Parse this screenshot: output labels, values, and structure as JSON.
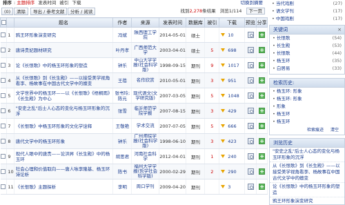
{
  "sortbar": {
    "label": "排序",
    "items": [
      "主题排序",
      "发表时间",
      "被引",
      "下载"
    ],
    "active_index": 0,
    "right_text": "切换到摘要"
  },
  "toolbar": {
    "buttons": [
      "(0)",
      "清除",
      "导出 / 参考文献",
      "分析 / 阅读"
    ],
    "result_prefix": "找到",
    "result_count": "2,278",
    "result_suffix": "条结果",
    "page_text": "浏览1/114",
    "next_label": "下一页"
  },
  "table": {
    "headers": [
      "",
      "题名",
      "作者",
      "来源",
      "发表时间",
      "数据库",
      "被引",
      "下载",
      "预览",
      "分享"
    ],
    "rows": [
      {
        "num": "1",
        "title": "鸦王环形象演变研究",
        "author": "冯斌",
        "source": "陕西理工学院",
        "date": "2014-05-01",
        "db": "硕士",
        "cite": "",
        "downloads": "10"
      },
      {
        "num": "2",
        "title": "唐诗贵妃题材研究",
        "author": "叶丹孝",
        "source": "广西师范大学",
        "date": "2003-04-01",
        "db": "硕士",
        "cite": "5",
        "downloads": "698"
      },
      {
        "num": "3",
        "title": "论《长恨歌》中的杨玉环形象的塑造",
        "author": "钟乐",
        "source": "中山大学学报(社会科学版)",
        "date": "1998-09-15",
        "db": "期刊",
        "cite": "9",
        "downloads": "1017"
      },
      {
        "num": "4",
        "title": "从《长恨歌》到《长生殿》——以接受美学视角看李、杨故事在中国古代文学中的嬗变",
        "author": "王蓓",
        "source": "名作欣赏",
        "date": "2010-05-01",
        "db": "期刊",
        "cite": "3",
        "downloads": "951"
      },
      {
        "num": "5",
        "title": "文学世界中的杨玉环——以《长恨歌》《梧桐雨》《长生殿》为中心",
        "author": "张书玲; 陈元",
        "source": "现代语文(文学研究版)",
        "date": "2007-03-05",
        "db": "期刊",
        "cite": "5",
        "downloads": "1048"
      },
      {
        "num": "6",
        "title": "\"安史之乱\"后士人心态的变化与杨玉环形象的沉浮",
        "author": "张雪",
        "source": "临沂师范学院学报",
        "date": "2007-08-15",
        "db": "期刊",
        "cite": "3",
        "downloads": "429"
      },
      {
        "num": "7",
        "title": "《长恨歌》中杨玉环形象的文化学诠释",
        "author": "王敬艳",
        "source": "学术交流",
        "date": "2007-07-05",
        "db": "期刊",
        "cite": "5",
        "downloads": "666"
      },
      {
        "num": "8",
        "title": "唐代文学中的杨玉环形象",
        "author": "钟乐",
        "source": "广州师院学报(社会科学版)",
        "date": "1998-06-10",
        "db": "期刊",
        "cite": "3",
        "downloads": "423"
      },
      {
        "num": "9",
        "title": "现代人眼中的唐贵——论洪昇《长生殿》中的杨玉环",
        "author": "胡思君",
        "source": "河南社会科学",
        "date": "2012-04-01",
        "db": "期刊",
        "cite": "1",
        "downloads": "240"
      },
      {
        "num": "10",
        "title": "社会心理和价值取向——唐人咏李隆基、杨玉环诗论析",
        "author": "陈书",
        "source": "福州大学学报(哲学社会科学版)",
        "date": "2000-02-29",
        "db": "期刊",
        "cite": "2",
        "downloads": "290"
      },
      {
        "num": "11",
        "title": "《长恨歌》主题探析",
        "author": "李明",
        "source": "周口学刊",
        "date": "2009-04-20",
        "db": "期刊",
        "cite": "",
        "downloads": "3"
      }
    ]
  },
  "sidebar": {
    "top_items": [
      {
        "label": "当代戏剧",
        "count": "(27)"
      },
      {
        "label": "语文学刊",
        "count": "(17)"
      },
      {
        "label": "中国戏剧",
        "count": "(17)"
      }
    ],
    "keywords_title": "关键词",
    "keywords": [
      {
        "label": "长恨歌",
        "count": "(54)"
      },
      {
        "label": "长生殿",
        "count": "(53)"
      },
      {
        "label": "长恨歌",
        "count": "(44)"
      },
      {
        "label": "杨玉环",
        "count": "(35)"
      },
      {
        "label": "白居易",
        "count": "(33)"
      }
    ],
    "search_history_title": "检索历史:",
    "search_history": [
      "杨玉环: 形象",
      "杨玉环: 形象",
      "形象",
      "杨玉环",
      "杨玉环"
    ],
    "search_history_link": "检索痕迹",
    "search_history_clear": "清空",
    "browse_history_title": "浏览历史",
    "browse_history": [
      "\"安史之乱\"后士人心态的变化与杨玉环形象的沉浮",
      "从《长恨歌》到《长生殿》——以接受美学视角看李、杨故事在中国古代文学中的嬗变",
      "论《长恨歌》中的杨玉环形象的塑造",
      "鸦王环形象演变研究"
    ]
  }
}
